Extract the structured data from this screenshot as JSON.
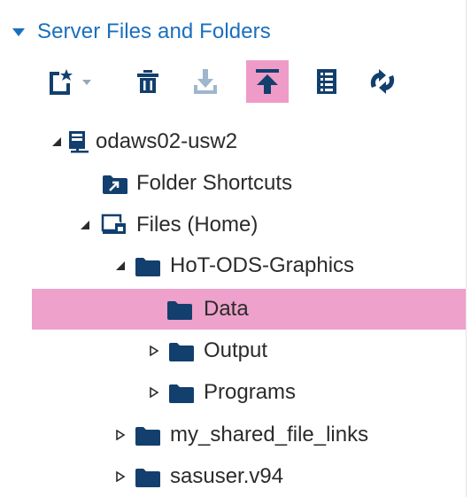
{
  "panel": {
    "title": "Server Files and Folders",
    "toolbar": {
      "new_tooltip": "New",
      "delete_tooltip": "Delete",
      "download_tooltip": "Download",
      "upload_tooltip": "Upload",
      "properties_tooltip": "Properties",
      "refresh_tooltip": "Refresh",
      "active_button": "upload"
    }
  },
  "tree": {
    "server": {
      "label": "odaws02-usw2",
      "expanded": true
    },
    "shortcuts": {
      "label": "Folder Shortcuts"
    },
    "home": {
      "label": "Files (Home)",
      "expanded": true
    },
    "items": [
      {
        "label": "HoT-ODS-Graphics",
        "expanded": true
      },
      {
        "label": "Data",
        "selected": true
      },
      {
        "label": "Output",
        "expanded": false
      },
      {
        "label": "Programs",
        "expanded": false
      },
      {
        "label": "my_shared_file_links",
        "expanded": false
      },
      {
        "label": "sasuser.v94",
        "expanded": false
      }
    ]
  },
  "colors": {
    "accent": "#1a6fbd",
    "folder": "#123f6d",
    "selection": "#eda1cb"
  }
}
